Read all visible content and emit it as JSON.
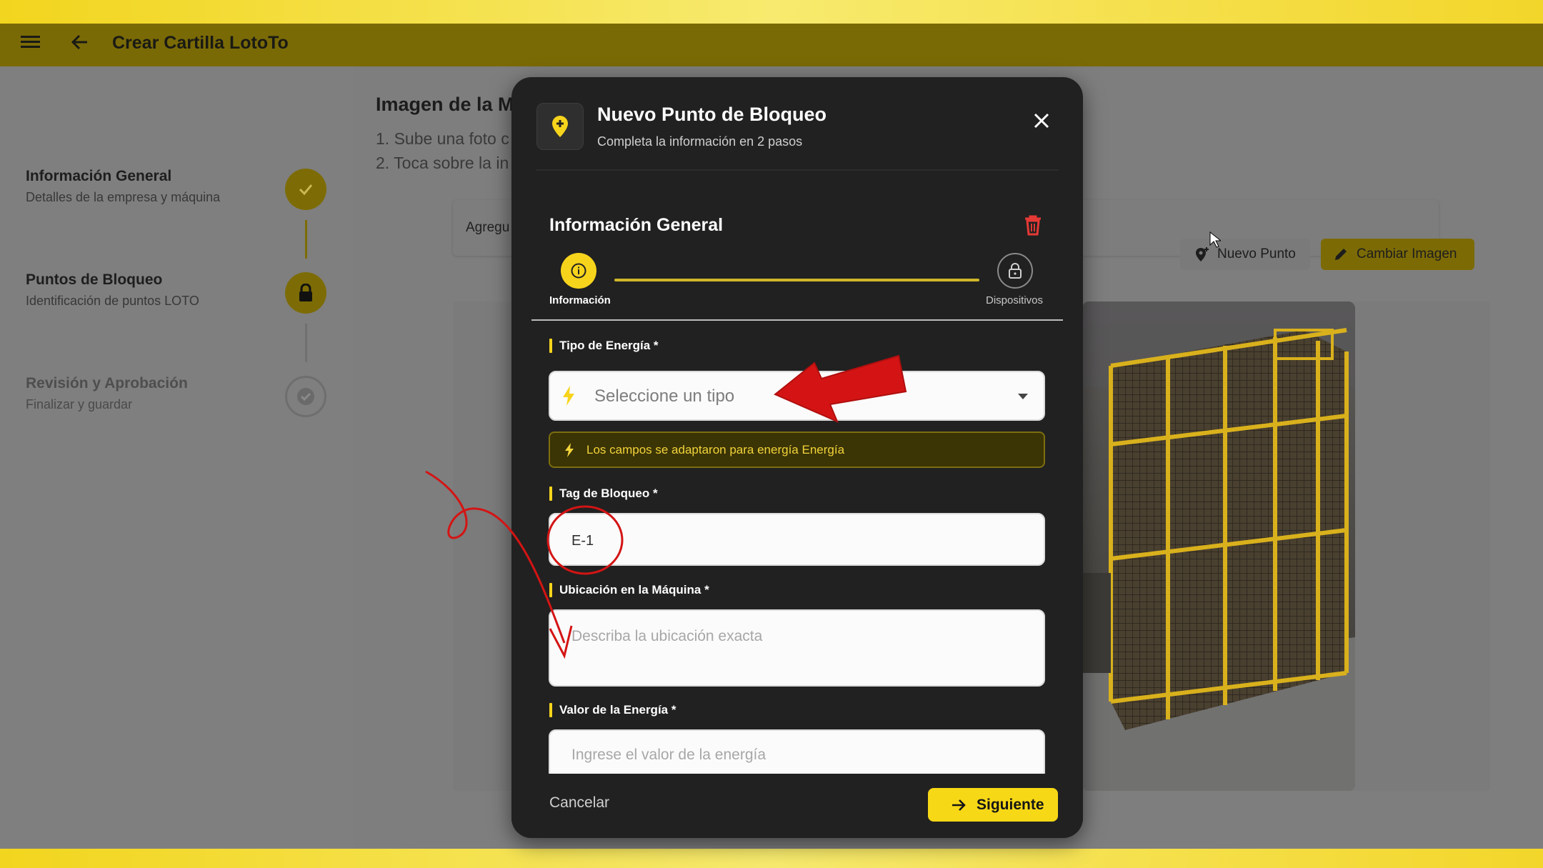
{
  "app": {
    "title": "Crear Cartilla LotoTo"
  },
  "sidebar": {
    "steps": [
      {
        "title": "Información General",
        "subtitle": "Detalles de la empresa y máquina",
        "state": "done"
      },
      {
        "title": "Puntos de Bloqueo",
        "subtitle": "Identificación de puntos LOTO",
        "state": "active"
      },
      {
        "title": "Revisión y Aprobación",
        "subtitle": "Finalizar y guardar",
        "state": "pending"
      }
    ]
  },
  "content": {
    "heading": "Imagen de la Má",
    "instructions": [
      "1. Sube una foto c",
      "2. Toca sobre la in"
    ],
    "toolbar_text": "Agregu",
    "nuevo_punto_label": "Nuevo Punto",
    "cambiar_imagen_label": "Cambiar Imagen"
  },
  "modal": {
    "title": "Nuevo Punto de Bloqueo",
    "subtitle": "Completa la información en 2 pasos",
    "section_title": "Información General",
    "stepper": {
      "step1_label": "Información",
      "step2_label": "Dispositivos"
    },
    "fields": {
      "tipo_energia_label": "Tipo de Energía *",
      "tipo_energia_placeholder": "Seleccione un tipo",
      "info_banner": "Los campos se adaptaron para energía Energía",
      "tag_label": "Tag de Bloqueo *",
      "tag_value": "E-1",
      "ubicacion_label": "Ubicación en la Máquina *",
      "ubicacion_placeholder": "Describa la ubicación exacta",
      "valor_label": "Valor de la Energía *",
      "valor_placeholder": "Ingrese el valor de la energía"
    },
    "cancel_label": "Cancelar",
    "next_label": "Siguiente"
  },
  "colors": {
    "accent": "#f7d816",
    "danger": "#e53935",
    "annotation": "#d41414"
  }
}
